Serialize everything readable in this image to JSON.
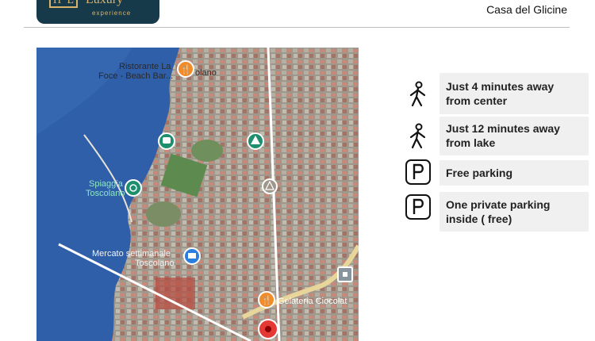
{
  "header": {
    "logo_mark": "H⁻L",
    "logo_brand": "Luxury",
    "logo_sub": "experience",
    "property_name": "Casa del Glicine"
  },
  "map": {
    "labels": {
      "restaurant_1": "Ristorante La",
      "restaurant_2": "Foce - Beach Bar...",
      "olano": "olano",
      "beach_1": "Spiaggia",
      "beach_2": "Toscolano",
      "market_1": "Mercato settimanale",
      "market_2": "Toscolano",
      "gelateria": "Gelateria Ciocolat"
    },
    "colors": {
      "water": "#2f5fa8",
      "land": "#a8a49a",
      "road": "#e8e2d8",
      "orange_pin": "#f28c28",
      "green_pin": "#1e8f6d",
      "blue_pin": "#2b7de0",
      "red_pin": "#e53935"
    }
  },
  "features": [
    {
      "icon": "walking-person-icon",
      "text_1": "Just 4  minutes away",
      "text_2": "from center"
    },
    {
      "icon": "walking-person-icon",
      "text_1": "Just 12 minutes away",
      "text_2": "from lake"
    },
    {
      "icon": "parking-icon",
      "text_1": "Free parking",
      "text_2": ""
    },
    {
      "icon": "parking-icon",
      "text_1": "One private parking",
      "text_2": "inside ( free)"
    }
  ]
}
